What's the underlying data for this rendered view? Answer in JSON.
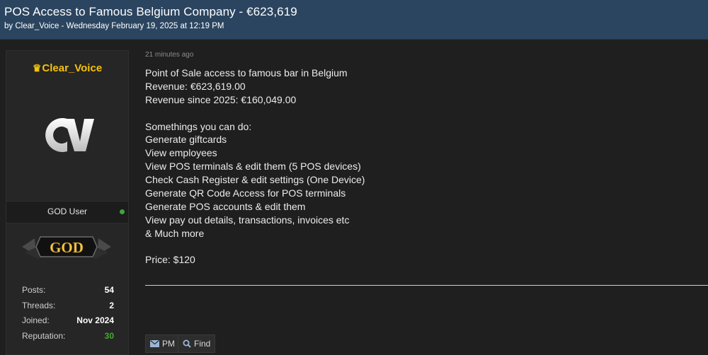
{
  "thread": {
    "title": "POS Access to Famous Belgium Company - €623,619",
    "byline": "by Clear_Voice - Wednesday February 19, 2025 at 12:19 PM"
  },
  "user": {
    "crown_icon": "crown-icon",
    "name": "Clear_Voice",
    "name_color": "#f4c20d",
    "avatar_letters": "CV",
    "rank": "GOD User",
    "online_color": "#3fa33f",
    "badge_text": "GOD",
    "stats": [
      {
        "label": "Posts:",
        "value": "54"
      },
      {
        "label": "Threads:",
        "value": "2"
      },
      {
        "label": "Joined:",
        "value": "Nov 2024"
      },
      {
        "label": "Reputation:",
        "value": "30"
      }
    ]
  },
  "post": {
    "time": "21 minutes ago",
    "lines": [
      "Point of Sale access to famous bar in Belgium",
      "Revenue:  €623,619.00",
      "Revenue since 2025: €160,049.00",
      "",
      "Somethings you can do:",
      "Generate giftcards",
      "View employees",
      "View POS terminals & edit them (5 POS devices)",
      "Check Cash Register & edit settings (One Device)",
      "Generate QR Code Access for POS terminals",
      "Generate POS accounts & edit them",
      "View pay out details, transactions, invoices etc",
      "& Much more",
      "",
      "Price: $120"
    ],
    "buttons": {
      "pm": "PM",
      "find": "Find"
    }
  },
  "colors": {
    "header_bg": "#2b4560",
    "page_bg": "#1f1f1f",
    "reputation": "#3fae2a"
  }
}
